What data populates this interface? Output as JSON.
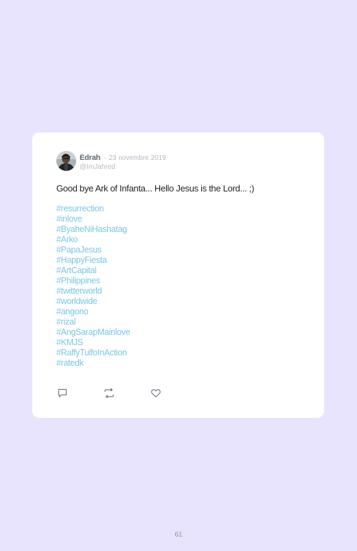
{
  "tweet": {
    "author_name": "Edrah",
    "separator": "·",
    "date": "23 novembre 2019",
    "handle": "@ImJahred",
    "text": "Good bye Ark of Infanta... Hello Jesus is the Lord... ;)",
    "hashtags": [
      "#resurrection",
      "#inlove",
      "#ByaheNiHashatag",
      "#Arko",
      "#PapaJesus",
      "#HappyFiesta",
      "#ArtCapital",
      "#Philippines",
      "#twitterworld",
      "#worldwide",
      "#angono",
      "#rizal",
      "#AngSarapMainlove",
      "#KMJS",
      "#RaffyTulfoInAction",
      "#ratedk"
    ],
    "actions": {
      "reply_icon": "reply-icon",
      "retweet_icon": "retweet-icon",
      "like_icon": "heart-icon"
    }
  },
  "page": {
    "number": "61"
  },
  "colors": {
    "background": "#e9e4fd",
    "card": "#ffffff",
    "hashtag": "#79c6e6",
    "muted": "#b3bac1"
  }
}
